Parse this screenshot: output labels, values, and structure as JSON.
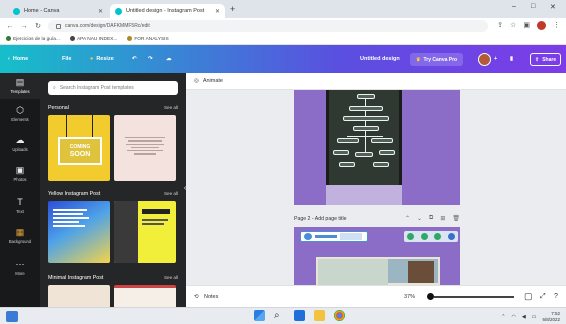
{
  "browser": {
    "tabs": [
      {
        "title": "Home - Canva",
        "active": false
      },
      {
        "title": "Untitled design - Instagram Post",
        "active": true
      }
    ],
    "new_tab_symbol": "+",
    "address": "canva.com/design/DAFKMMF5Rc/edit",
    "bookmarks": [
      "Ejercicios de la guía...",
      "APA NAU INDEX...",
      "FOR ANALYSIS"
    ],
    "window_controls": [
      "–",
      "□",
      "✕"
    ]
  },
  "canva_bar": {
    "home": "Home",
    "file": "File",
    "resize": "Resize",
    "title": "Untitled design",
    "try_pro": "Try Canva Pro",
    "share": "Share",
    "plus": "+"
  },
  "rail": [
    {
      "label": "Templates",
      "icon": "▤"
    },
    {
      "label": "Elements",
      "icon": "⬡"
    },
    {
      "label": "Uploads",
      "icon": "☁"
    },
    {
      "label": "Photos",
      "icon": "▣"
    },
    {
      "label": "Text",
      "icon": "T"
    },
    {
      "label": "Background",
      "icon": "▦"
    },
    {
      "label": "More",
      "icon": "⋯"
    }
  ],
  "panel": {
    "search_placeholder": "Search Instagram Post templates",
    "sections": [
      {
        "title": "Personal",
        "see_all": "See all"
      },
      {
        "title": "Yellow Instagram Post",
        "see_all": "See all"
      },
      {
        "title": "Minimal Instagram Post",
        "see_all": "See all"
      }
    ],
    "coming_soon_line1": "COMING",
    "coming_soon_line2": "SOON",
    "scroll_handle": "‹"
  },
  "workspace": {
    "animate": "Animate",
    "page2_label": "Page 2 - Add page title"
  },
  "bottom": {
    "notes": "Notes",
    "zoom": "37%"
  },
  "taskbar": {
    "time": "7:52",
    "date": "6/8/2022"
  },
  "colors": {
    "canva_gradient_start": "#16bfc9",
    "canva_gradient_end": "#7d3ce8",
    "panel_bg": "#252627",
    "page_bg": "#8b6cc7"
  }
}
